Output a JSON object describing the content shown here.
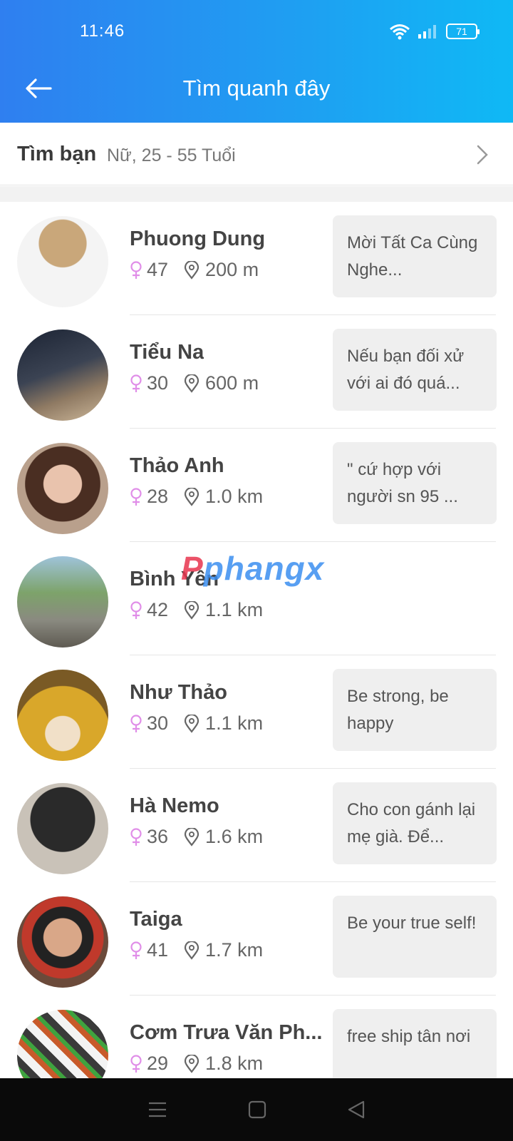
{
  "status_bar": {
    "time": "11:46",
    "battery": "71"
  },
  "app_bar": {
    "title": "Tìm quanh đây"
  },
  "filter": {
    "label": "Tìm bạn",
    "value": "Nữ, 25 - 55 Tuổi"
  },
  "watermark": {
    "part1": "P",
    "part2": "phangx"
  },
  "people": [
    {
      "name": "Phuong Dung",
      "age": "47",
      "distance": "200 m",
      "status": "Mời Tất Ca Cùng Nghe..."
    },
    {
      "name": "Tiểu Na",
      "age": "30",
      "distance": "600 m",
      "status": "Nếu bạn đối xử với ai đó quá..."
    },
    {
      "name": "Thảo Anh",
      "age": "28",
      "distance": "1.0 km",
      "status": "\" cứ hợp với người sn 95 ..."
    },
    {
      "name": "Bình Yên",
      "age": "42",
      "distance": "1.1 km",
      "status": ""
    },
    {
      "name": "Như Thảo",
      "age": "30",
      "distance": "1.1 km",
      "status": "Be strong, be happy"
    },
    {
      "name": "Hà Nemo",
      "age": "36",
      "distance": "1.6 km",
      "status": "Cho con gánh lại mẹ già. Để..."
    },
    {
      "name": "Taiga",
      "age": "41",
      "distance": "1.7 km",
      "status": "Be your true self!"
    },
    {
      "name": "Cơm Trưa Văn Ph...",
      "age": "29",
      "distance": "1.8 km",
      "status": "free ship tân nơi"
    }
  ],
  "colors": {
    "header_start": "#2f7ff0",
    "header_end": "#0fb9f5",
    "female_icon": "#e08ee8"
  }
}
